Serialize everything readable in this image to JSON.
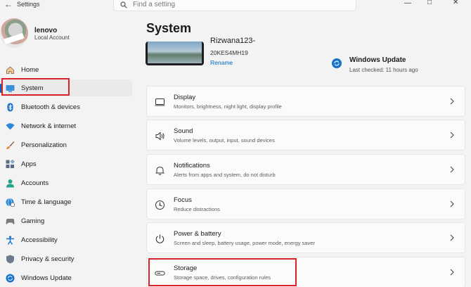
{
  "window": {
    "app_title": "Settings"
  },
  "search": {
    "placeholder": "Find a setting"
  },
  "profile": {
    "name": "lenovo",
    "account_type": "Local Account"
  },
  "sidebar": {
    "items": [
      {
        "label": "Home",
        "icon": "home-icon"
      },
      {
        "label": "System",
        "icon": "system-icon",
        "selected": true
      },
      {
        "label": "Bluetooth & devices",
        "icon": "bluetooth-icon"
      },
      {
        "label": "Network & internet",
        "icon": "wifi-icon"
      },
      {
        "label": "Personalization",
        "icon": "brush-icon"
      },
      {
        "label": "Apps",
        "icon": "apps-icon"
      },
      {
        "label": "Accounts",
        "icon": "accounts-icon"
      },
      {
        "label": "Time & language",
        "icon": "globe-clock-icon"
      },
      {
        "label": "Gaming",
        "icon": "gamepad-icon"
      },
      {
        "label": "Accessibility",
        "icon": "accessibility-icon"
      },
      {
        "label": "Privacy & security",
        "icon": "shield-icon"
      },
      {
        "label": "Windows Update",
        "icon": "update-icon"
      }
    ]
  },
  "main": {
    "title": "System",
    "device": {
      "name": "Rizwana123-",
      "model": "20KES4MH19",
      "rename_label": "Rename"
    },
    "windows_update": {
      "title": "Windows Update",
      "status": "Last checked: 11 hours ago"
    },
    "cards": [
      {
        "title": "Display",
        "subtitle": "Monitors, brightness, night light, display profile",
        "icon": "display-icon"
      },
      {
        "title": "Sound",
        "subtitle": "Volume levels, output, input, sound devices",
        "icon": "speaker-icon"
      },
      {
        "title": "Notifications",
        "subtitle": "Alerts from apps and system, do not disturb",
        "icon": "bell-icon"
      },
      {
        "title": "Focus",
        "subtitle": "Reduce distractions",
        "icon": "focus-icon"
      },
      {
        "title": "Power & battery",
        "subtitle": "Screen and sleep, battery usage, power mode, energy saver",
        "icon": "power-icon"
      },
      {
        "title": "Storage",
        "subtitle": "Storage space, drives, configuration rules",
        "icon": "storage-icon"
      }
    ]
  },
  "colors": {
    "accent": "#0067c0",
    "highlight_box": "#d9222a",
    "background": "#f3f3f3"
  }
}
